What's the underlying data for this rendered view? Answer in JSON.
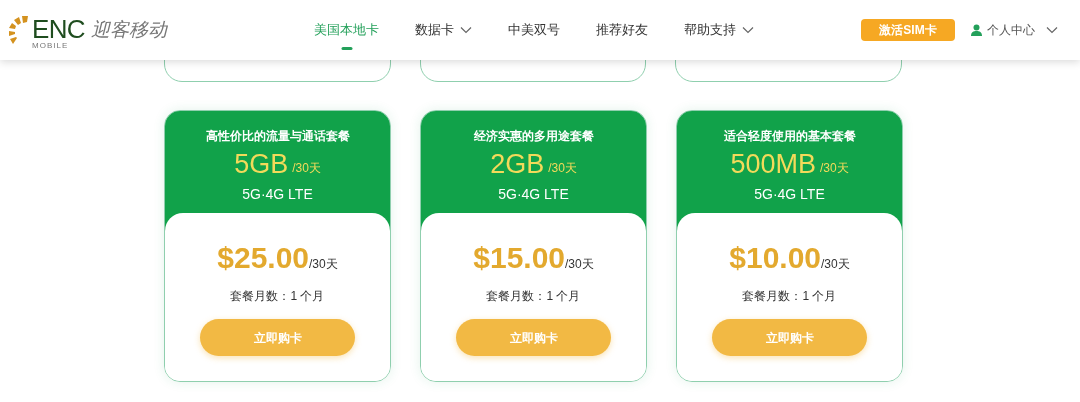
{
  "logo": {
    "mark": "ENC",
    "sub": "MOBILE",
    "name": "迎客移动"
  },
  "nav": [
    {
      "label": "美国本地卡",
      "selected": true,
      "dropdown": false
    },
    {
      "label": "数据卡",
      "selected": false,
      "dropdown": true
    },
    {
      "label": "中美双号",
      "selected": false,
      "dropdown": false
    },
    {
      "label": "推荐好友",
      "selected": false,
      "dropdown": false
    },
    {
      "label": "帮助支持",
      "selected": false,
      "dropdown": true
    }
  ],
  "activate_button": "激活SIM卡",
  "account": {
    "label": "个人中心"
  },
  "plans": [
    {
      "tagline": "高性价比的流量与通话套餐",
      "data": "5GB",
      "period": "/30天",
      "network": "5G·4G LTE",
      "price": "$25.00",
      "price_period": "/30天",
      "months": "套餐月数：1 个月",
      "button": "立即购卡"
    },
    {
      "tagline": "经济实惠的多用途套餐",
      "data": "2GB",
      "period": "/30天",
      "network": "5G·4G LTE",
      "price": "$15.00",
      "price_period": "/30天",
      "months": "套餐月数：1 个月",
      "button": "立即购卡"
    },
    {
      "tagline": "适合轻度使用的基本套餐",
      "data": "500MB",
      "period": "/30天",
      "network": "5G·4G LTE",
      "price": "$10.00",
      "price_period": "/30天",
      "months": "套餐月数：1 个月",
      "button": "立即购卡"
    }
  ]
}
